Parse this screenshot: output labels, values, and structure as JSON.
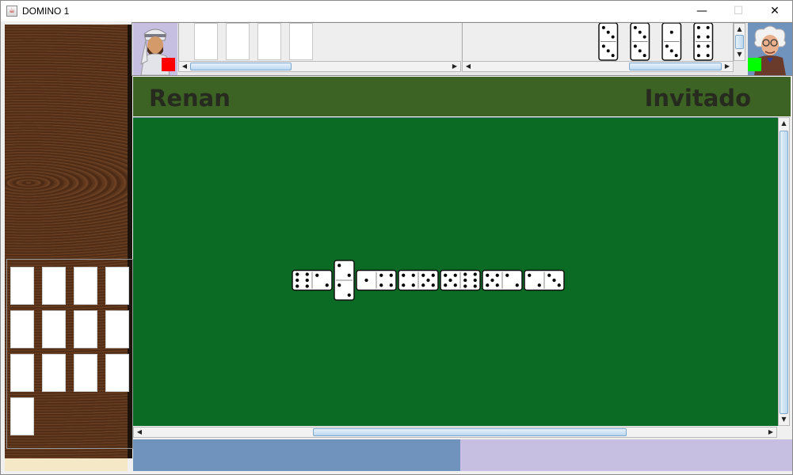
{
  "window": {
    "title": "DOMINO 1",
    "minimize": "—",
    "maximize": "☐",
    "close": "✕"
  },
  "players": {
    "left": {
      "name": "Renan",
      "indicator_color": "#ff0000",
      "avatar": "sheikh-avatar"
    },
    "right": {
      "name": "Invitado",
      "indicator_color": "#00ff00",
      "avatar": "professor-avatar"
    }
  },
  "left_hand": {
    "cards": 4
  },
  "right_hand": {
    "tiles": [
      [
        3,
        3
      ],
      [
        3,
        3
      ],
      [
        1,
        3
      ],
      [
        4,
        4
      ]
    ]
  },
  "boneyard": {
    "cards": 13
  },
  "board": {
    "chain": [
      [
        6,
        2
      ],
      [
        2,
        2
      ],
      [
        1,
        4
      ],
      [
        4,
        5
      ],
      [
        5,
        6
      ],
      [
        5,
        2
      ],
      [
        2,
        3
      ]
    ],
    "background": "#0b6a23"
  },
  "colors": {
    "namebar": "#3c6224",
    "wood": "#553019",
    "footer_left": "#7093bd",
    "footer_right": "#c7bfe2"
  }
}
